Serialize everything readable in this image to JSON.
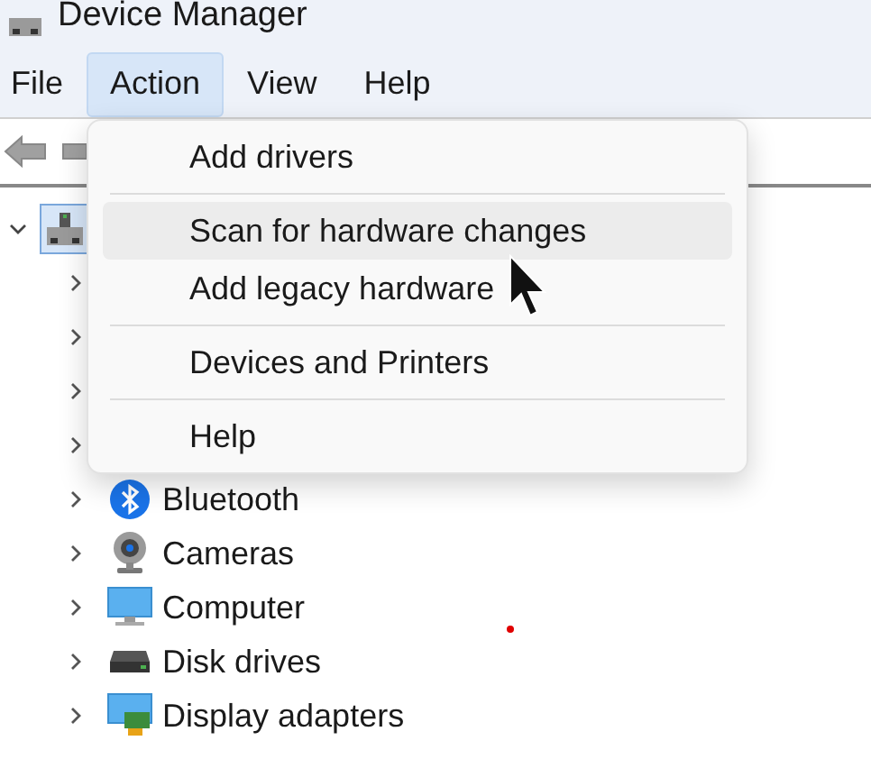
{
  "window": {
    "title": "Device Manager"
  },
  "menu_bar": [
    {
      "label": "File",
      "selected": false
    },
    {
      "label": "Action",
      "selected": true
    },
    {
      "label": "View",
      "selected": false
    },
    {
      "label": "Help",
      "selected": false
    }
  ],
  "dropdown": [
    {
      "kind": "item",
      "label": "Add drivers",
      "selected": false
    },
    {
      "kind": "separator"
    },
    {
      "kind": "item",
      "label": "Scan for hardware changes",
      "selected": true
    },
    {
      "kind": "item",
      "label": "Add legacy hardware",
      "selected": false
    },
    {
      "kind": "separator"
    },
    {
      "kind": "item",
      "label": "Devices and Printers",
      "selected": false
    },
    {
      "kind": "separator"
    },
    {
      "kind": "item",
      "label": "Help",
      "selected": false
    }
  ],
  "tree": {
    "expanded": true,
    "selected": true,
    "children": [
      {
        "expanded": false
      },
      {
        "expanded": false
      },
      {
        "expanded": false
      },
      {
        "expanded": false
      },
      {
        "label": "Bluetooth",
        "expanded": false
      },
      {
        "label": "Cameras",
        "expanded": false
      },
      {
        "label": "Computer",
        "expanded": false
      },
      {
        "label": "Disk drives",
        "expanded": false
      },
      {
        "label": "Display adapters",
        "expanded": false
      }
    ]
  }
}
